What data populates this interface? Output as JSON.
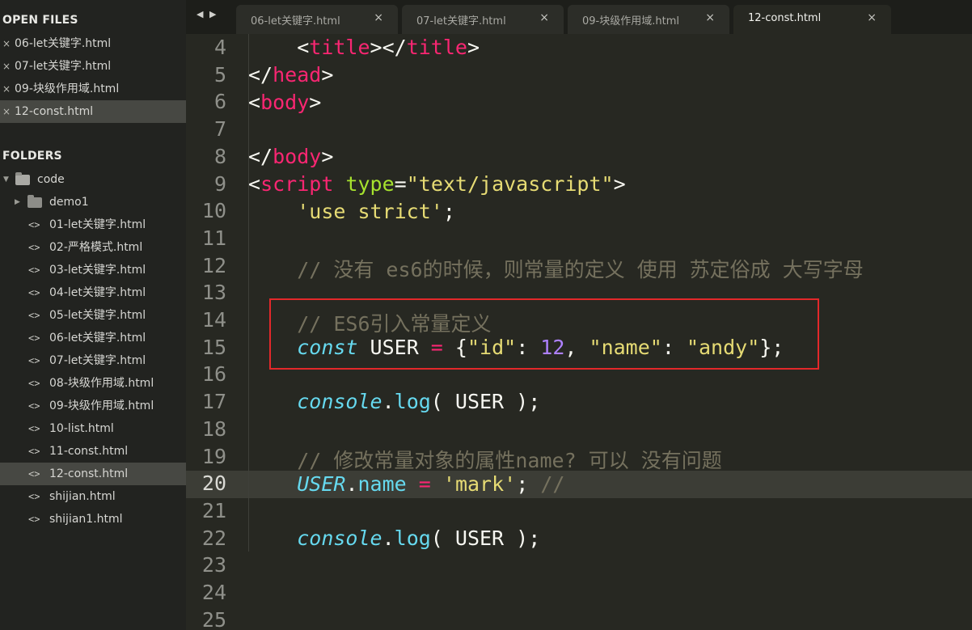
{
  "sidebar": {
    "open_files_heading": "OPEN FILES",
    "open_files": [
      {
        "name": "06-let关键字.html"
      },
      {
        "name": "07-let关键字.html"
      },
      {
        "name": "09-块级作用域.html"
      },
      {
        "name": "12-const.html",
        "active": true
      }
    ],
    "folders_heading": "FOLDERS",
    "root_folder": "code",
    "subfolder": "demo1",
    "files": [
      "01-let关键字.html",
      "02-严格模式.html",
      "03-let关键字.html",
      "04-let关键字.html",
      "05-let关键字.html",
      "06-let关键字.html",
      "07-let关键字.html",
      "08-块级作用域.html",
      "09-块级作用域.html",
      "10-list.html",
      "11-const.html",
      "12-const.html",
      "shijian.html",
      "shijian1.html"
    ],
    "active_file_index": 11,
    "close_glyph": "×"
  },
  "tabbar": {
    "prev_icon": "◀",
    "next_icon": "▶",
    "tabs": [
      {
        "label": "06-let关键字.html"
      },
      {
        "label": "07-let关键字.html"
      },
      {
        "label": "09-块级作用域.html"
      },
      {
        "label": "12-const.html",
        "active": true
      }
    ],
    "close_glyph": "×"
  },
  "editor": {
    "active_line": "20",
    "line_numbers": [
      "4",
      "5",
      "6",
      "7",
      "8",
      "9",
      "10",
      "11",
      "12",
      "13",
      "14",
      "15",
      "16",
      "17",
      "18",
      "19",
      "20",
      "21",
      "22",
      "23",
      "24",
      "25"
    ],
    "code": {
      "l4": {
        "indent": "    ",
        "a": "<",
        "b": "title",
        "c": "></",
        "d": "title",
        "e": ">"
      },
      "l5": {
        "a": "</",
        "b": "head",
        "c": ">"
      },
      "l6": {
        "a": "<",
        "b": "body",
        "c": ">"
      },
      "l8": {
        "a": "</",
        "b": "body",
        "c": ">"
      },
      "l9": {
        "a": "<",
        "b": "script",
        "c": " ",
        "d": "type",
        "e": "=",
        "f": "\"text/javascript\"",
        "g": ">"
      },
      "l10": {
        "indent": "    ",
        "a": "'use strict'",
        "b": ";"
      },
      "l12": {
        "indent": "    ",
        "a": "// 没有 es6的时候，则常量的定义 使用 苏定俗成 大写字母"
      },
      "l14": {
        "indent": "    ",
        "a": "// ES6引入常量定义"
      },
      "l15": {
        "indent": "    ",
        "a": "const",
        "b": " USER ",
        "c": "=",
        "d": " {",
        "e": "\"id\"",
        "f": ": ",
        "g": "12",
        "h": ", ",
        "i": "\"name\"",
        "j": ": ",
        "k": "\"andy\"",
        "l": "};"
      },
      "l17": {
        "indent": "    ",
        "a": "console",
        "b": ".",
        "c": "log",
        "d": "( USER );"
      },
      "l19": {
        "indent": "    ",
        "a": "// 修改常量对象的属性name? 可以 没有问题"
      },
      "l20": {
        "indent": "    ",
        "a": "USER",
        "b": ".",
        "c": "name",
        "d": " ",
        "e": "=",
        "f": " ",
        "g": "'mark'",
        "h": "; ",
        "i": "//"
      },
      "l22": {
        "indent": "    ",
        "a": "console",
        "b": ".",
        "c": "log",
        "d": "( USER );"
      }
    }
  },
  "colors": {
    "background": "#272822",
    "sidebar": "#222320",
    "tag": "#f92672",
    "attribute": "#a6e22e",
    "string": "#e6db74",
    "comment": "#75715e",
    "keyword": "#66d9ef",
    "number": "#ae81ff",
    "highlight_box": "#e3282a"
  }
}
